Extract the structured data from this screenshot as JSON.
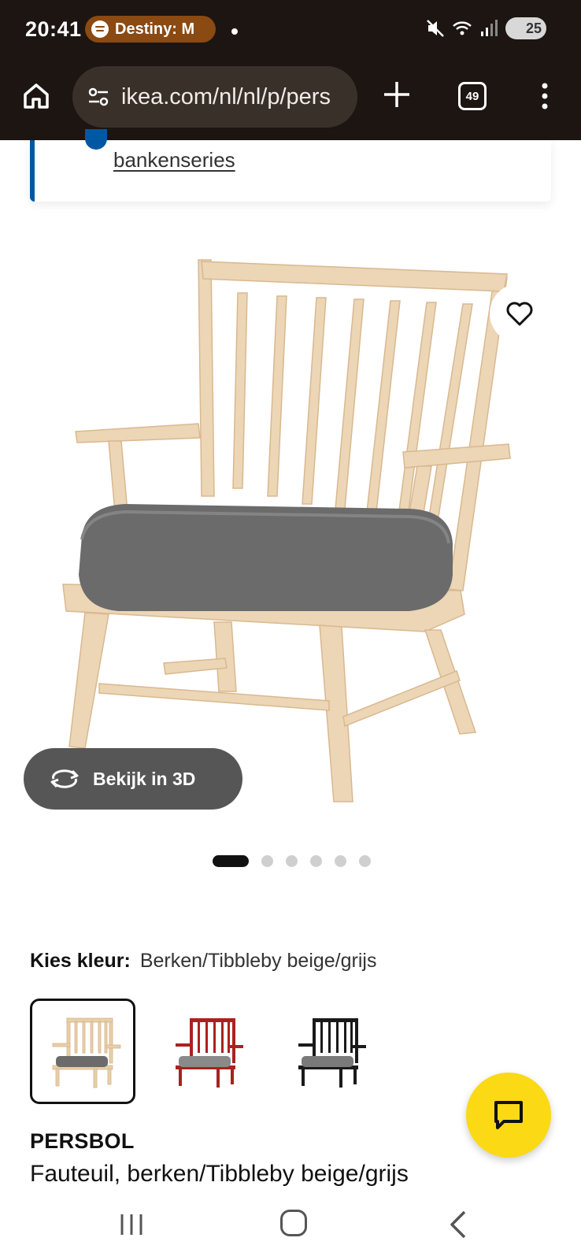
{
  "status_bar": {
    "time": "20:41",
    "spotify_text": "Destiny: M",
    "battery": "25",
    "icons": [
      "spotify-icon",
      "mute-icon",
      "wifi-icon",
      "signal-icon",
      "battery-icon"
    ]
  },
  "browser": {
    "url": "ikea.com/nl/nl/p/pers",
    "tab_count": "49",
    "icons": [
      "home-icon",
      "tune-icon",
      "plus-icon",
      "tabs-icon",
      "more-vert-icon"
    ]
  },
  "info_card": {
    "link_text": "bankenseries",
    "accent": "#0058a3"
  },
  "gallery": {
    "view_3d_label": "Bekijk in 3D",
    "dot_count": 6,
    "active_dot": 0,
    "favorite_icon": "heart-icon"
  },
  "color_chooser": {
    "label": "Kies kleur:",
    "value": "Berken/Tibbleby beige/grijs",
    "options": [
      {
        "name": "berken",
        "frame": "#e8cfaa",
        "selected": true
      },
      {
        "name": "rood",
        "frame": "#a8231f",
        "selected": false
      },
      {
        "name": "zwart",
        "frame": "#1a1a1a",
        "selected": false
      }
    ]
  },
  "product": {
    "name": "PERSBOL",
    "description": "Fauteuil, berken/Tibbleby beige/grijs"
  },
  "chat": {
    "icon": "chat-icon",
    "color": "#fbd914"
  },
  "nav": {
    "icons": [
      "recents-icon",
      "home-icon",
      "back-icon"
    ]
  }
}
